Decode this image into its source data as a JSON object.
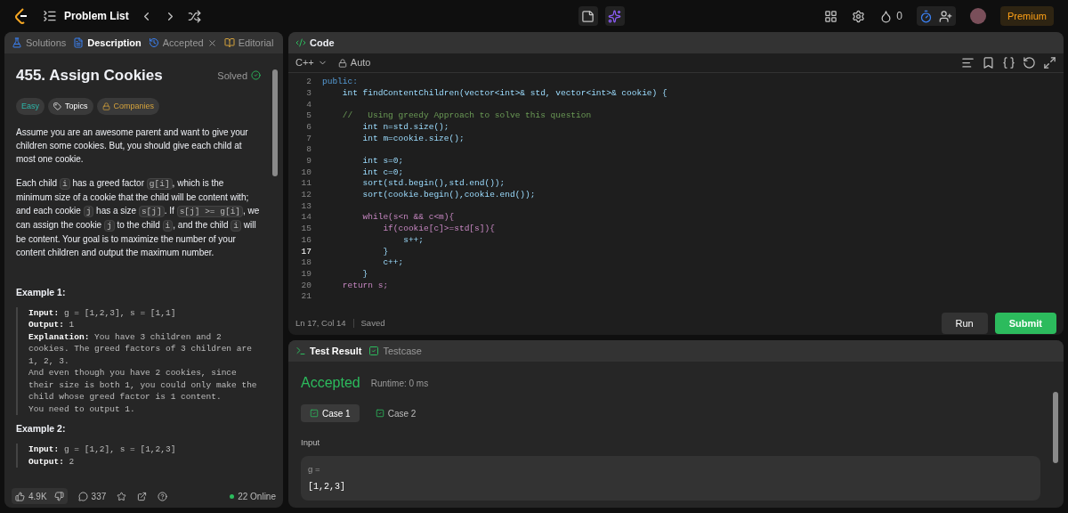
{
  "top_bar": {
    "title": "Problem List",
    "streak": "0",
    "premium": "Premium"
  },
  "left_tabs": [
    {
      "label": "Solutions",
      "selected": false,
      "closable": false
    },
    {
      "label": "Description",
      "selected": true,
      "closable": false
    },
    {
      "label": "Accepted",
      "selected": false,
      "closable": true
    },
    {
      "label": "Editorial",
      "selected": false,
      "closable": false
    }
  ],
  "problem": {
    "title": "455. Assign Cookies",
    "status": "Solved",
    "difficulty": "Easy",
    "tags": [
      "Topics",
      "Companies"
    ],
    "paragraphs": [
      [
        {
          "kind": "text",
          "text": "Assume you are an awesome parent and want to give your children some cookies. But, you should give each child at most one cookie."
        }
      ],
      [
        {
          "kind": "text",
          "text": "Each child "
        },
        {
          "kind": "code",
          "text": "i"
        },
        {
          "kind": "text",
          "text": " has a greed factor "
        },
        {
          "kind": "code",
          "text": "g[i]"
        },
        {
          "kind": "text",
          "text": ", which is the minimum size of a cookie that the child will be content with; and each cookie "
        },
        {
          "kind": "code",
          "text": "j"
        },
        {
          "kind": "text",
          "text": " has a size "
        },
        {
          "kind": "code",
          "text": "s[j]"
        },
        {
          "kind": "text",
          "text": ". If "
        },
        {
          "kind": "code",
          "text": "s[j] >= g[i]"
        },
        {
          "kind": "text",
          "text": ", we can assign the cookie "
        },
        {
          "kind": "code",
          "text": "j"
        },
        {
          "kind": "text",
          "text": " to the child "
        },
        {
          "kind": "code",
          "text": "i"
        },
        {
          "kind": "text",
          "text": ", and the child "
        },
        {
          "kind": "code",
          "text": "i"
        },
        {
          "kind": "text",
          "text": " will be content. Your goal is to maximize the number of your content children and output the maximum number."
        }
      ]
    ],
    "examples": [
      {
        "title": "Example 1:",
        "lines": [
          "**Input:** g = [1,2,3], s = [1,1]",
          "**Output:** 1",
          "**Explanation:** You have 3 children and 2 cookies. The greed factors of 3 children are 1, 2, 3.",
          "And even though you have 2 cookies, since their size is both 1, you could only make the child whose greed factor is 1 content.",
          "You need to output 1."
        ]
      },
      {
        "title": "Example 2:",
        "lines": [
          "**Input:** g = [1,2], s = [1,2,3]",
          "**Output:** 2"
        ]
      }
    ]
  },
  "footer": {
    "likes": "4.9K",
    "comments": "337",
    "online": "22 Online"
  },
  "code_panel": {
    "title": "Code",
    "language": "C++",
    "mode": "Auto",
    "lines": [
      {
        "number": "2",
        "text": "public:",
        "kind": "keyword"
      },
      {
        "number": "3",
        "text": "    int findContentChildren(vector<int>& std, vector<int>& cookie) {",
        "kind": "code"
      },
      {
        "number": "4"
      },
      {
        "number": "5",
        "text": "    //   Using greedy Approach to solve this question",
        "kind": "comment"
      },
      {
        "number": "6",
        "text": "        int n=std.size();",
        "kind": "code"
      },
      {
        "number": "7",
        "text": "        int m=cookie.size();",
        "kind": "code"
      },
      {
        "number": "8"
      },
      {
        "number": "9",
        "text": "        int s=0;",
        "kind": "code"
      },
      {
        "number": "10",
        "text": "        int c=0;",
        "kind": "code"
      },
      {
        "number": "11",
        "text": "        sort(std.begin(),std.end());",
        "kind": "code"
      },
      {
        "number": "12",
        "text": "        sort(cookie.begin(),cookie.end());",
        "kind": "code"
      },
      {
        "number": "13"
      },
      {
        "number": "14",
        "text": "        while(s<n && c<m){",
        "kind": "control"
      },
      {
        "number": "15",
        "text": "            if(cookie[c]>=std[s]){",
        "kind": "control"
      },
      {
        "number": "16",
        "text": "                s++;",
        "kind": "code"
      },
      {
        "number": "17",
        "text": "            }",
        "kind": "code",
        "current": true
      },
      {
        "number": "18",
        "text": "            c++;",
        "kind": "code"
      },
      {
        "number": "19",
        "text": "        }",
        "kind": "code"
      },
      {
        "number": "20",
        "text": "    return s;",
        "kind": "control"
      },
      {
        "number": "21"
      }
    ],
    "status": "Ln 17, Col 14",
    "saved": "Saved",
    "run": "Run",
    "submit": "Submit"
  },
  "test_panel": {
    "tabs": [
      {
        "label": "Test Result",
        "selected": true
      },
      {
        "label": "Testcase",
        "selected": false
      }
    ],
    "verdict": "Accepted",
    "runtime": "Runtime: 0 ms",
    "cases": [
      {
        "label": "Case 1",
        "selected": true
      },
      {
        "label": "Case 2",
        "selected": false
      }
    ],
    "input_label": "Input",
    "inputs": [
      {
        "name": "g =",
        "value": "[1,2,3]"
      }
    ]
  }
}
